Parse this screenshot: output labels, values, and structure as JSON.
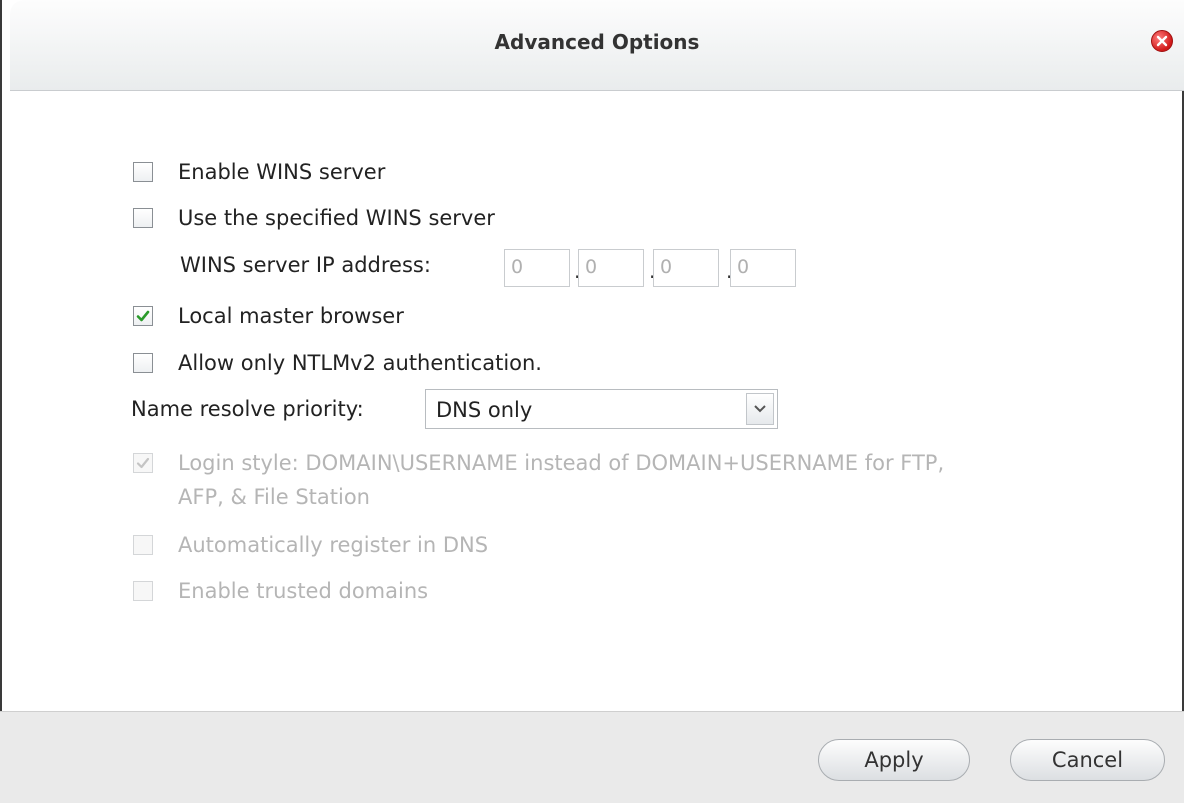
{
  "dialog": {
    "title": "Advanced Options",
    "close_icon": "close-icon"
  },
  "options": {
    "enable_wins": {
      "label": "Enable WINS server",
      "checked": false,
      "enabled": true
    },
    "use_specified_wins": {
      "label": "Use the specified WINS server",
      "checked": false,
      "enabled": true
    },
    "wins_ip": {
      "label": "WINS server IP address:",
      "octets": [
        "0",
        "0",
        "0",
        "0"
      ],
      "separator": "."
    },
    "local_master_browser": {
      "label": "Local master browser",
      "checked": true,
      "enabled": true
    },
    "ntlmv2_only": {
      "label": "Allow only NTLMv2 authentication.",
      "checked": false,
      "enabled": true
    },
    "name_resolve_priority": {
      "label": "Name resolve priority:",
      "selected": "DNS only"
    },
    "login_style": {
      "label_line1": "Login style: DOMAIN\\USERNAME instead of DOMAIN+USERNAME for FTP,",
      "label_line2": "AFP, & File Station",
      "checked": true,
      "enabled": false
    },
    "auto_register_dns": {
      "label": "Automatically register in DNS",
      "checked": false,
      "enabled": false
    },
    "trusted_domains": {
      "label": "Enable trusted domains",
      "checked": false,
      "enabled": false
    }
  },
  "footer": {
    "apply_label": "Apply",
    "cancel_label": "Cancel"
  },
  "colors": {
    "close_red": "#d01818",
    "check_green": "#2a9a2a",
    "disabled_text": "#b5b5b5"
  }
}
